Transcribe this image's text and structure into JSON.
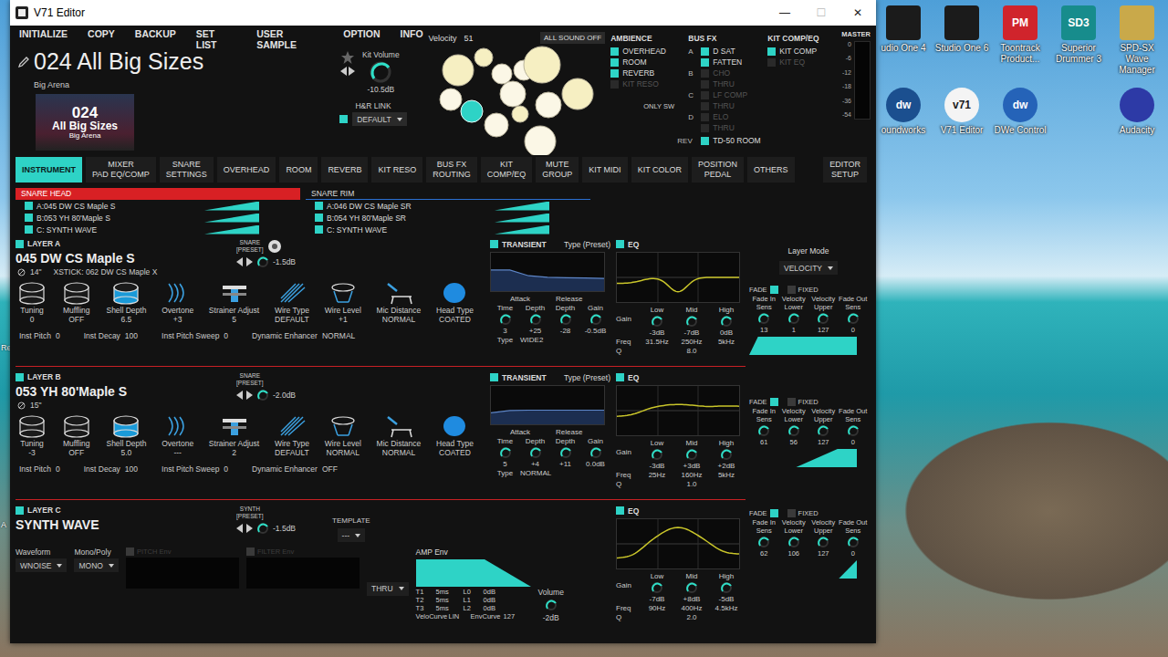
{
  "window": {
    "title": "V71 Editor",
    "controls": [
      {
        "label": "—",
        "disabled": false
      },
      {
        "label": "☐",
        "disabled": true
      },
      {
        "label": "✕",
        "disabled": false
      }
    ]
  },
  "menu": [
    "INITIALIZE",
    "COPY",
    "BACKUP",
    "SET LIST",
    "USER SAMPLE",
    "OPTION",
    "INFO"
  ],
  "kit": {
    "name": "024 All Big Sizes",
    "subtitle": "Big Arena",
    "thumb_number": "024",
    "thumb_name": "All Big Sizes",
    "thumb_subtitle": "Big Arena",
    "volume_label": "Kit Volume",
    "volume": "-10.5dB",
    "favorite": false
  },
  "hr_link": {
    "label": "H&R LINK",
    "value": "DEFAULT",
    "on": true
  },
  "velocity": {
    "label": "Velocity",
    "value": "51"
  },
  "all_sound_off": "ALL SOUND OFF",
  "pads": [
    {
      "kind": "cymbal",
      "selected": false
    },
    {
      "kind": "cymbal",
      "selected": false
    },
    {
      "kind": "drum",
      "selected": false
    },
    {
      "kind": "drum",
      "selected": false
    },
    {
      "kind": "cymbal",
      "selected": false
    },
    {
      "kind": "cymbal",
      "selected": false
    },
    {
      "kind": "drum",
      "selected": false
    },
    {
      "kind": "drum",
      "selected": true
    },
    {
      "kind": "drum",
      "selected": false
    },
    {
      "kind": "drum",
      "selected": false
    },
    {
      "kind": "drum",
      "selected": false
    },
    {
      "kind": "drum",
      "selected": false
    },
    {
      "kind": "cymbal",
      "selected": false
    }
  ],
  "ambience": {
    "title": "AMBIENCE",
    "items": [
      {
        "label": "OVERHEAD",
        "on": true,
        "disabled": false
      },
      {
        "label": "ROOM",
        "on": true,
        "disabled": false
      },
      {
        "label": "REVERB",
        "on": true,
        "disabled": false
      },
      {
        "label": "KIT RESO",
        "on": false,
        "disabled": true
      }
    ],
    "only_sw": "ONLY SW"
  },
  "bus_fx": {
    "title": "BUS FX",
    "slots": [
      {
        "letter": "A",
        "items": [
          {
            "label": "D SAT",
            "on": true,
            "disabled": false
          },
          {
            "label": "FATTEN",
            "on": true,
            "disabled": false
          }
        ]
      },
      {
        "letter": "B",
        "items": [
          {
            "label": "CHO",
            "on": false,
            "disabled": true
          },
          {
            "label": "THRU",
            "on": false,
            "disabled": true
          }
        ]
      },
      {
        "letter": "C",
        "items": [
          {
            "label": "LF COMP",
            "on": false,
            "disabled": true
          },
          {
            "label": "THRU",
            "on": false,
            "disabled": true
          }
        ]
      },
      {
        "letter": "D",
        "items": [
          {
            "label": "ELO",
            "on": false,
            "disabled": true
          },
          {
            "label": "THRU",
            "on": false,
            "disabled": true
          }
        ]
      }
    ],
    "rev_label": "REV",
    "rev_value": "TD-50 ROOM",
    "rev_on": true
  },
  "kit_comp_eq": {
    "title": "KIT COMP/EQ",
    "items": [
      {
        "label": "KIT COMP",
        "on": true,
        "disabled": false
      },
      {
        "label": "KIT EQ",
        "on": false,
        "disabled": true
      }
    ]
  },
  "master": {
    "title": "MASTER",
    "scale": [
      "0",
      "-6",
      "-12",
      "-18",
      "-36",
      "-54"
    ],
    "level": 0.0
  },
  "tabs": [
    {
      "label": "INSTRUMENT",
      "selected": true
    },
    {
      "label": "MIXER\nPAD EQ/COMP",
      "selected": false
    },
    {
      "label": "SNARE\nSETTINGS",
      "selected": false
    },
    {
      "label": "OVERHEAD",
      "selected": false
    },
    {
      "label": "ROOM",
      "selected": false
    },
    {
      "label": "REVERB",
      "selected": false
    },
    {
      "label": "KIT RESO",
      "selected": false
    },
    {
      "label": "BUS FX\nROUTING",
      "selected": false
    },
    {
      "label": "KIT\nCOMP/EQ",
      "selected": false
    },
    {
      "label": "MUTE\nGROUP",
      "selected": false
    },
    {
      "label": "KIT MIDI",
      "selected": false
    },
    {
      "label": "KIT COLOR",
      "selected": false
    },
    {
      "label": "POSITION\nPEDAL",
      "selected": false
    },
    {
      "label": "OTHERS",
      "selected": false
    }
  ],
  "setup_tab": {
    "label": "EDITOR\nSETUP",
    "selected": false
  },
  "snare_lists": [
    {
      "title": "SNARE HEAD",
      "selected": true,
      "items": [
        {
          "label": "A:045 DW CS Maple S",
          "on": true,
          "level": 1
        },
        {
          "label": "B:053 YH 80'Maple S",
          "on": true,
          "level": 1
        },
        {
          "label": "C: SYNTH WAVE",
          "on": true,
          "level": 1
        }
      ]
    },
    {
      "title": "SNARE RIM",
      "selected": false,
      "items": [
        {
          "label": "A:046 DW CS Maple SR",
          "on": true,
          "level": 1
        },
        {
          "label": "B:054 YH 80'Maple SR",
          "on": true,
          "level": 1
        },
        {
          "label": "C: SYNTH WAVE",
          "on": true,
          "level": 1
        }
      ]
    }
  ],
  "layer_mode": {
    "label": "Layer Mode",
    "value": "VELOCITY"
  },
  "layers": [
    {
      "kind": "drum",
      "title": "LAYER A",
      "on": true,
      "preview": true,
      "tag": [
        "SNARE",
        "[PRESET]"
      ],
      "name": "045 DW CS Maple S",
      "size": "14\"",
      "xstick": "XSTICK: 062 DW CS Maple X",
      "level": "-1.5dB",
      "params": [
        {
          "label": "Tuning",
          "value": "0",
          "highlight": false
        },
        {
          "label": "Muffling",
          "value": "OFF",
          "highlight": false
        },
        {
          "label": "Shell Depth",
          "value": "6.5",
          "highlight": true
        },
        {
          "label": "Overtone",
          "value": "+3",
          "highlight": false
        },
        {
          "label": "Strainer Adjust",
          "value": "5",
          "highlight": false
        },
        {
          "label": "Wire Type",
          "value": "DEFAULT",
          "highlight": false
        },
        {
          "label": "Wire Level",
          "value": "+1",
          "highlight": false
        },
        {
          "label": "Mic Distance",
          "value": "NORMAL",
          "highlight": false
        },
        {
          "label": "Head Type",
          "value": "COATED",
          "highlight": false
        }
      ],
      "footer": [
        {
          "label": "Inst Pitch",
          "value": "0"
        },
        {
          "label": "Inst Decay",
          "value": "100"
        },
        {
          "label": "Inst Pitch Sweep",
          "value": "0"
        },
        {
          "label": "Dynamic Enhancer",
          "value": "NORMAL"
        }
      ],
      "transient": {
        "title": "TRANSIENT",
        "type_label": "Type (Preset)",
        "on": true,
        "groups": [
          "Attack",
          "Release"
        ],
        "knobs": [
          {
            "label": "Time",
            "value": "3"
          },
          {
            "label": "Depth",
            "value": "+25"
          },
          {
            "label": "Depth",
            "value": "-28"
          },
          {
            "label": "Gain",
            "value": "-0.5dB"
          }
        ],
        "type": "Type",
        "type_value": "WIDE2",
        "curve": [
          0.55,
          0.55,
          0.4,
          0.36,
          0.35,
          0.34,
          0.33
        ]
      },
      "eq": {
        "title": "EQ",
        "on": true,
        "bands": [
          "Low",
          "Mid",
          "High"
        ],
        "gain_label": "Gain",
        "gains": [
          "-3dB",
          "-7dB",
          "0dB"
        ],
        "freq_label": "Freq",
        "freqs": [
          "31.5Hz",
          "250Hz",
          "5kHz"
        ],
        "q_label": "Q",
        "q": "8.0",
        "curve_db": [
          -3,
          -7,
          0
        ]
      },
      "fade": {
        "fade_label": "FADE",
        "fade_on": true,
        "fixed_label": "FIXED",
        "fixed_on": false,
        "knobs": [
          {
            "label": "Fade In Sens",
            "value": "13"
          },
          {
            "label": "Velocity Lower",
            "value": "1"
          },
          {
            "label": "Velocity Upper",
            "value": "127"
          },
          {
            "label": "Fade Out Sens",
            "value": "0"
          }
        ],
        "velocity_range": [
          1,
          127
        ],
        "fade_in_sens": 13
      }
    },
    {
      "kind": "drum",
      "title": "LAYER B",
      "on": true,
      "preview": false,
      "tag": [
        "SNARE",
        "[PRESET]"
      ],
      "name": "053 YH 80'Maple S",
      "size": "15\"",
      "level": "-2.0dB",
      "params": [
        {
          "label": "Tuning",
          "value": "-3",
          "highlight": false
        },
        {
          "label": "Muffling",
          "value": "OFF",
          "highlight": false
        },
        {
          "label": "Shell Depth",
          "value": "5.0",
          "highlight": true
        },
        {
          "label": "Overtone",
          "value": "---",
          "highlight": false
        },
        {
          "label": "Strainer Adjust",
          "value": "2",
          "highlight": false
        },
        {
          "label": "Wire Type",
          "value": "DEFAULT",
          "highlight": false
        },
        {
          "label": "Wire Level",
          "value": "NORMAL",
          "highlight": false
        },
        {
          "label": "Mic Distance",
          "value": "NORMAL",
          "highlight": false
        },
        {
          "label": "Head Type",
          "value": "COATED",
          "highlight": false
        }
      ],
      "footer": [
        {
          "label": "Inst Pitch",
          "value": "0"
        },
        {
          "label": "Inst Decay",
          "value": "100"
        },
        {
          "label": "Inst Pitch Sweep",
          "value": "0"
        },
        {
          "label": "Dynamic Enhancer",
          "value": "OFF"
        }
      ],
      "transient": {
        "title": "TRANSIENT",
        "type_label": "Type (Preset)",
        "on": true,
        "groups": [
          "Attack",
          "Release"
        ],
        "knobs": [
          {
            "label": "Time",
            "value": "5"
          },
          {
            "label": "Depth",
            "value": "+4"
          },
          {
            "label": "Depth",
            "value": "+11"
          },
          {
            "label": "Gain",
            "value": "0.0dB"
          }
        ],
        "type": "Type",
        "type_value": "NORMAL",
        "curve": [
          0.3,
          0.36,
          0.37,
          0.37,
          0.37,
          0.37,
          0.37
        ]
      },
      "eq": {
        "title": "EQ",
        "on": true,
        "bands": [
          "Low",
          "Mid",
          "High"
        ],
        "gain_label": "Gain",
        "gains": [
          "-3dB",
          "+3dB",
          "+2dB"
        ],
        "freq_label": "Freq",
        "freqs": [
          "25Hz",
          "160Hz",
          "5kHz"
        ],
        "q_label": "Q",
        "q": "1.0",
        "curve_db": [
          -3,
          3,
          2
        ]
      },
      "fade": {
        "fade_label": "FADE",
        "fade_on": true,
        "fixed_label": "FIXED",
        "fixed_on": false,
        "knobs": [
          {
            "label": "Fade In Sens",
            "value": "61"
          },
          {
            "label": "Velocity Lower",
            "value": "56"
          },
          {
            "label": "Velocity Upper",
            "value": "127"
          },
          {
            "label": "Fade Out Sens",
            "value": "0"
          }
        ],
        "velocity_range": [
          56,
          127
        ],
        "fade_in_sens": 61
      }
    },
    {
      "kind": "synth",
      "title": "LAYER C",
      "on": true,
      "preview": false,
      "tag": [
        "SYNTH",
        "[PRESET]"
      ],
      "name": "SYNTH WAVE",
      "level": "-1.5dB",
      "template_label": "TEMPLATE",
      "template": "---",
      "waveform_label": "Waveform",
      "waveform": "WNOISE",
      "mono_label": "Mono/Poly",
      "mono": "MONO",
      "pitch_env": "PITCH Env",
      "pitch_env_on": false,
      "filter_env": "FILTER Env",
      "filter_env_on": false,
      "filter_type": "THRU",
      "amp": {
        "title": "AMP Env",
        "rows": [
          [
            "T1",
            "5ms",
            "L0",
            "0dB"
          ],
          [
            "T2",
            "5ms",
            "L1",
            "0dB"
          ],
          [
            "T3",
            "5ms",
            "L2",
            "0dB"
          ]
        ],
        "velo_curve_label": "VeloCurve",
        "velo_curve": "LIN",
        "env_curve_label": "EnvCurve",
        "env_curve": "127",
        "volume_label": "Volume",
        "volume": "-2dB"
      },
      "eq": {
        "title": "EQ",
        "on": true,
        "bands": [
          "Low",
          "Mid",
          "High"
        ],
        "gain_label": "Gain",
        "gains": [
          "-7dB",
          "+8dB",
          "-5dB"
        ],
        "freq_label": "Freq",
        "freqs": [
          "90Hz",
          "400Hz",
          "4.5kHz"
        ],
        "q_label": "Q",
        "q": "2.0",
        "curve_db": [
          -7,
          8,
          -5
        ]
      },
      "fade": {
        "fade_label": "FADE",
        "fade_on": true,
        "fixed_label": "FIXED",
        "fixed_on": false,
        "knobs": [
          {
            "label": "Fade In Sens",
            "value": "62"
          },
          {
            "label": "Velocity Lower",
            "value": "106"
          },
          {
            "label": "Velocity Upper",
            "value": "127"
          },
          {
            "label": "Fade Out Sens",
            "value": "0"
          }
        ],
        "velocity_range": [
          106,
          127
        ],
        "fade_in_sens": 62
      }
    }
  ],
  "desktop": {
    "icon_rows": [
      [
        {
          "label": "udio One 4",
          "color": "#1b1b1b"
        },
        {
          "label": "Studio One 6",
          "color": "#1b1b1b"
        },
        {
          "label": "Toontrack Product...",
          "glyph": "PM",
          "color": "#d0242c"
        },
        {
          "label": "Superior Drummer 3",
          "glyph": "SD3",
          "color": "#178c8c"
        },
        {
          "label": "SPD-SX Wave Manager",
          "color": "#c9a94a"
        }
      ],
      [
        {
          "label": "oundworks",
          "glyph": "dw",
          "color": "#1b4f8f"
        },
        {
          "label": "V71 Editor",
          "glyph": "v71",
          "color": "#f4f4f4"
        },
        {
          "label": "DWe Control",
          "glyph": "dw",
          "color": "#2563b8"
        },
        {
          "label": "Audacity",
          "color": "#2d3aa6"
        }
      ]
    ],
    "edge_fragments": [
      "Re",
      "A"
    ]
  }
}
